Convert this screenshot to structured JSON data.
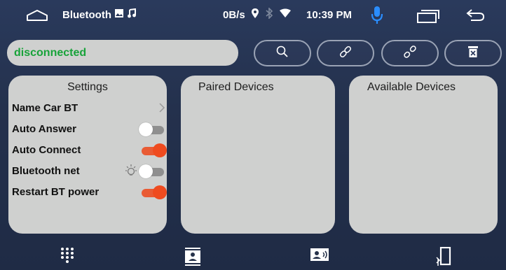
{
  "status_bar": {
    "app_title": "Bluetooth",
    "net_rate": "0B/s",
    "time": "10:39 PM"
  },
  "connection": {
    "status_text": "disconnected",
    "status_color": "#18a33a"
  },
  "toolbar": {
    "buttons": [
      "search",
      "link",
      "unlink",
      "delete"
    ]
  },
  "settings_panel": {
    "title": "Settings",
    "name_label": "Name",
    "device_name": "Car BT",
    "items": [
      {
        "label": "Auto Answer",
        "state": "off"
      },
      {
        "label": "Auto Connect",
        "state": "on"
      },
      {
        "label": "Bluetooth net",
        "state": "off"
      },
      {
        "label": "Restart BT power",
        "state": "on"
      }
    ]
  },
  "paired_panel": {
    "title": "Paired Devices"
  },
  "available_panel": {
    "title": "Available Devices"
  },
  "bottom_tabs": [
    "dialpad",
    "call-log",
    "contacts",
    "music-transfer"
  ],
  "colors": {
    "accent_orange": "#e95b34",
    "panel_bg": "#cfd0cf",
    "mic_blue": "#2a8dff"
  }
}
